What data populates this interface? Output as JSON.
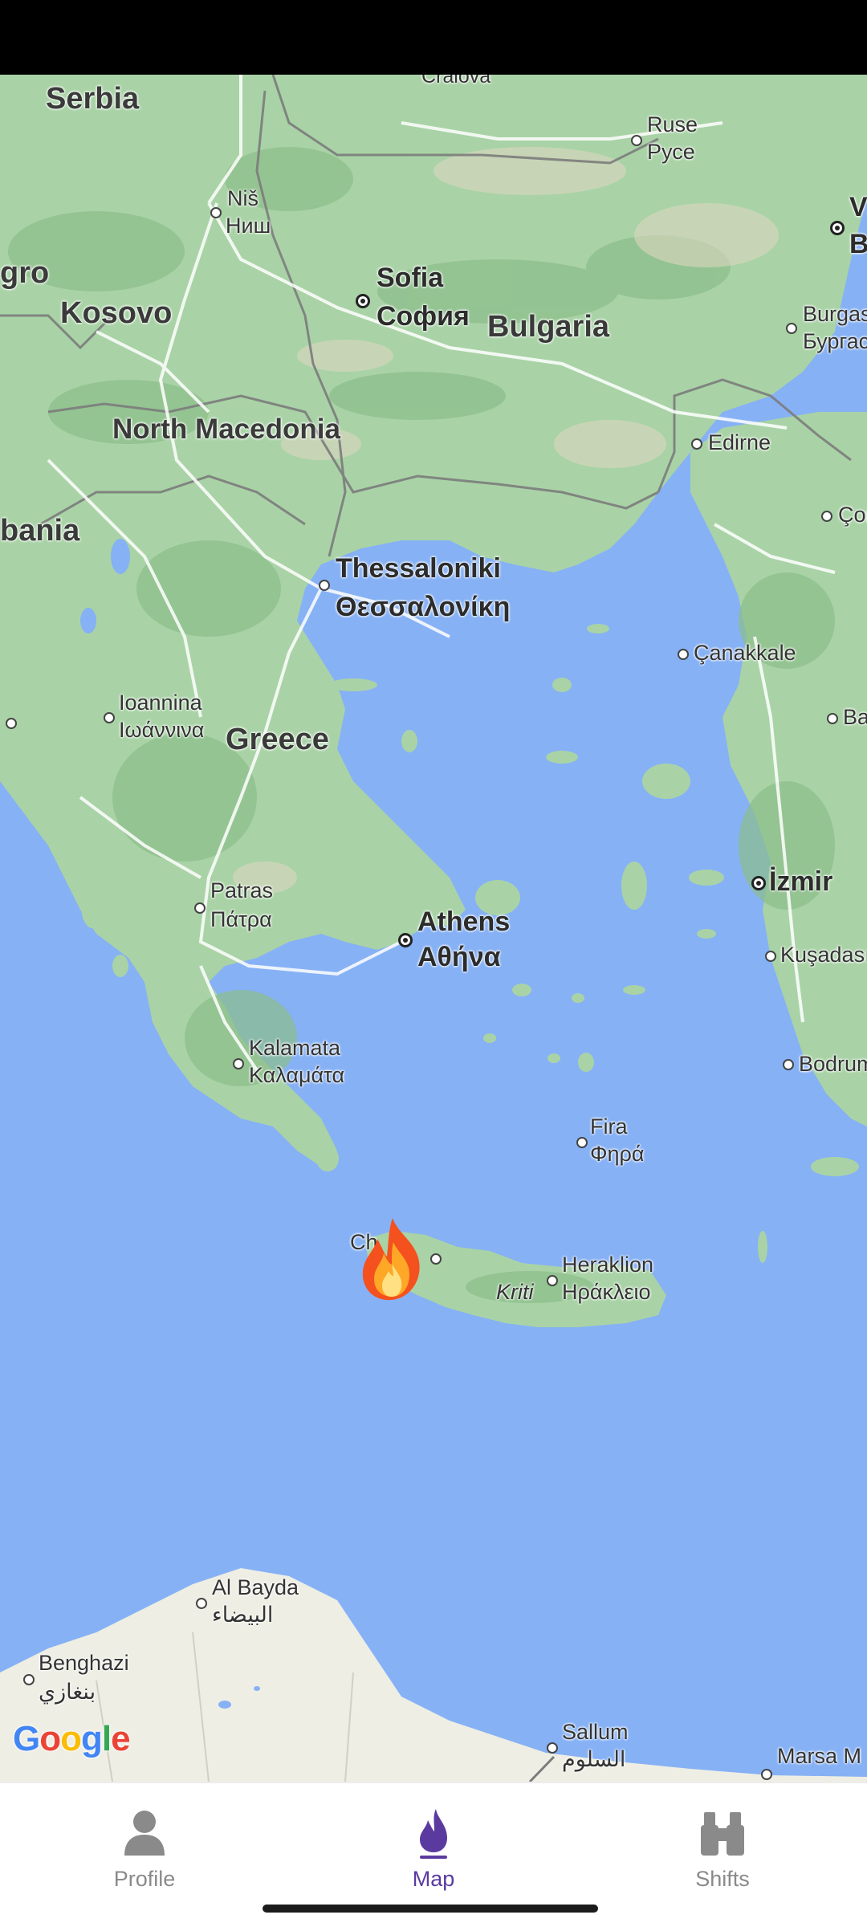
{
  "map": {
    "countries": [
      "Serbia",
      "Kosovo",
      "North Macedonia",
      "bania",
      "Bulgaria",
      "Greece",
      "gro"
    ],
    "cities": {
      "sofia_en": "Sofia",
      "sofia_local": "София",
      "athens_en": "Athens",
      "athens_local": "Αθήνα",
      "thessaloniki_en": "Thessaloniki",
      "thessaloniki_local": "Θεσσαλονίκη",
      "nis_en": "Niš",
      "nis_local": "Ниш",
      "ruse_en": "Ruse",
      "ruse_local": "Русе",
      "burgas_en": "Burgas",
      "burgas_local": "Бургас",
      "edirne": "Edirne",
      "canakkale": "Çanakkale",
      "izmir": "İzmir",
      "kusadasi": "Kuşadası",
      "bodrum": "Bodrum",
      "ioannina_en": "Ioannina",
      "ioannina_local": "Ιωάννινα",
      "patras_en": "Patras",
      "patras_local": "Πάτρα",
      "kalamata_en": "Kalamata",
      "kalamata_local": "Καλαμάτα",
      "fira_en": "Fira",
      "fira_local": "Φηρά",
      "heraklion_en": "Heraklion",
      "heraklion_local": "Ηράκλειο",
      "chania_partial": "Ch",
      "kriti": "Kriti",
      "albayda_en": "Al Bayda",
      "albayda_local": "البيضاء",
      "benghazi_en": "Benghazi",
      "benghazi_local": "بنغازي",
      "sallum_en": "Sallum",
      "sallum_local": "السلوم",
      "marsa_en": "Marsa M",
      "craiova_partial": "Craiova",
      "corlu_partial": "Çor",
      "ba_partial": "Ba",
      "v_partial": "V",
      "b_partial": "B"
    },
    "attribution": "Google",
    "marker_icon": "fire-icon"
  },
  "nav": {
    "items": [
      {
        "label": "Profile",
        "icon": "person-icon",
        "active": false
      },
      {
        "label": "Map",
        "icon": "flame-icon",
        "active": true
      },
      {
        "label": "Shifts",
        "icon": "binoculars-icon",
        "active": false
      }
    ]
  },
  "colors": {
    "sea": "#86b1f5",
    "land": "#a9d3a6",
    "accent": "#5b3aa0",
    "inactive": "#8a8a8a"
  }
}
